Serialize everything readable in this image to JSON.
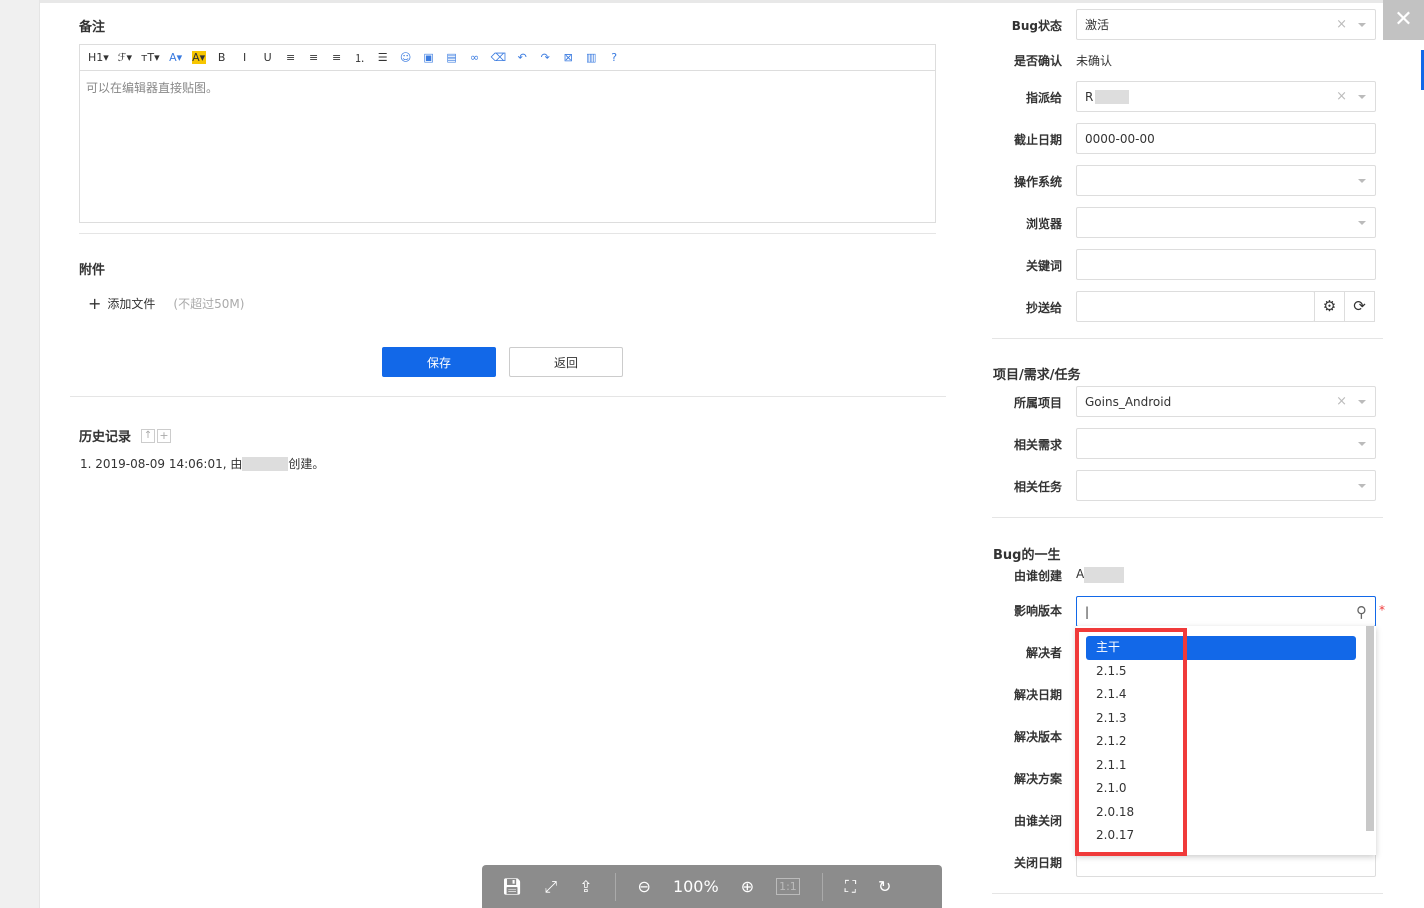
{
  "left": {
    "remark_title": "备注",
    "toolbar": [
      "H1▾",
      "ℱ▾",
      "тT▾",
      "A▾",
      "A▾",
      "B",
      "I",
      "U",
      "≡",
      "≡",
      "≡",
      "⒈",
      "☰",
      "☺",
      "▣",
      "▤",
      "∞",
      "⌫",
      "↶",
      "↷",
      "⊠",
      "▥",
      "?"
    ],
    "editor_placeholder": "可以在编辑器直接贴图。",
    "attachments_title": "附件",
    "add_file": "添加文件",
    "file_limit": "(不超过50M)",
    "save": "保存",
    "back": "返回",
    "history_title": "历史记录",
    "history": [
      "1. 2019-08-09 14:06:01, 由",
      "创建。"
    ]
  },
  "right": {
    "fields": [
      {
        "label": "Bug状态",
        "value": "激活"
      },
      {
        "label": "是否确认",
        "value": "未确认"
      },
      {
        "label": "指派给",
        "value": "R"
      },
      {
        "label": "截止日期",
        "value": "0000-00-00"
      },
      {
        "label": "操作系统",
        "value": ""
      },
      {
        "label": "浏览器",
        "value": ""
      },
      {
        "label": "关键词",
        "value": ""
      },
      {
        "label": "抄送给",
        "value": ""
      }
    ],
    "section2": "项目/需求/任务",
    "fields2": [
      {
        "label": "所属项目",
        "value": "Goins_Android"
      },
      {
        "label": "相关需求",
        "value": ""
      },
      {
        "label": "相关任务",
        "value": ""
      }
    ],
    "section3": "Bug的一生",
    "created_by_label": "由谁创建",
    "created_by": "A",
    "version_label": "影响版本",
    "required": "*",
    "labels3": [
      "解决者",
      "解决日期",
      "解决版本",
      "解决方案",
      "由谁关闭",
      "关闭日期"
    ],
    "versions": [
      "主干",
      "2.1.5",
      "2.1.4",
      "2.1.3",
      "2.1.2",
      "2.1.1",
      "2.1.0",
      "2.0.18",
      "2.0.17"
    ]
  },
  "viewer": {
    "zoom": "100%",
    "one_to_one": "1:1"
  },
  "colors": {
    "primary": "#1268e8",
    "highlight": "#f03a3a"
  }
}
